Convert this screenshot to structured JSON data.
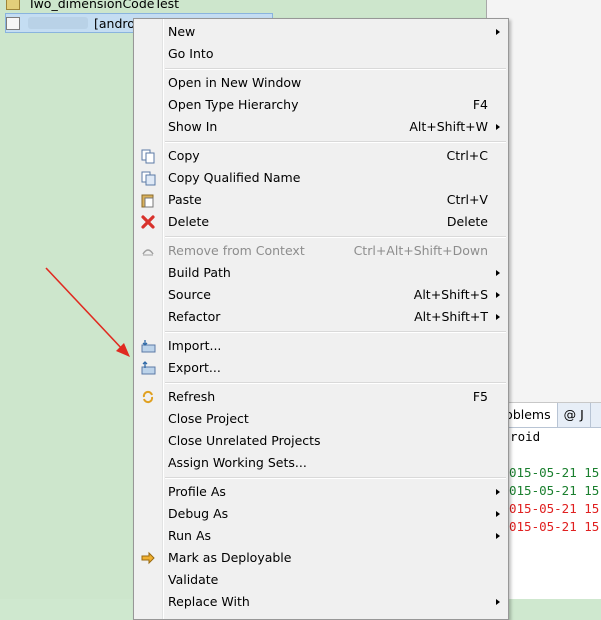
{
  "explorer": {
    "rows": [
      {
        "label": "Two_dimensionCodeTest"
      },
      {
        "label": "[android]"
      }
    ]
  },
  "right_panel": {
    "tabs": [
      {
        "label": "Problems"
      },
      {
        "label": "@ J"
      }
    ],
    "console_header": "ndroid",
    "log_lines": [
      {
        "text": "015-05-21 15",
        "color": "#1a7f2e"
      },
      {
        "text": "015-05-21 15",
        "color": "#1a7f2e"
      },
      {
        "text": "015-05-21 15",
        "color": "#e02020"
      },
      {
        "text": "015-05-21 15",
        "color": "#e02020"
      }
    ]
  },
  "menu": {
    "items": [
      {
        "label": "New",
        "shortcut": "",
        "submenu": true
      },
      {
        "label": "Go Into",
        "shortcut": ""
      },
      {
        "label": "Open in New Window",
        "shortcut": ""
      },
      {
        "label": "Open Type Hierarchy",
        "shortcut": "F4"
      },
      {
        "label": "Show In",
        "shortcut": "Alt+Shift+W",
        "submenu": true
      },
      {
        "label": "Copy",
        "shortcut": "Ctrl+C",
        "icon": "copy-icon"
      },
      {
        "label": "Copy Qualified Name",
        "shortcut": "",
        "icon": "copy-qualified-name-icon"
      },
      {
        "label": "Paste",
        "shortcut": "Ctrl+V",
        "icon": "paste-icon"
      },
      {
        "label": "Delete",
        "shortcut": "Delete",
        "icon": "delete-icon"
      },
      {
        "label": "Remove from Context",
        "shortcut": "Ctrl+Alt+Shift+Down",
        "icon": "remove-context-icon",
        "disabled": true
      },
      {
        "label": "Build Path",
        "shortcut": "",
        "submenu": true
      },
      {
        "label": "Source",
        "shortcut": "Alt+Shift+S",
        "submenu": true
      },
      {
        "label": "Refactor",
        "shortcut": "Alt+Shift+T",
        "submenu": true
      },
      {
        "label": "Import...",
        "shortcut": "",
        "icon": "import-icon"
      },
      {
        "label": "Export...",
        "shortcut": "",
        "icon": "export-icon"
      },
      {
        "label": "Refresh",
        "shortcut": "F5",
        "icon": "refresh-icon"
      },
      {
        "label": "Close Project",
        "shortcut": ""
      },
      {
        "label": "Close Unrelated Projects",
        "shortcut": ""
      },
      {
        "label": "Assign Working Sets...",
        "shortcut": ""
      },
      {
        "label": "Profile As",
        "shortcut": "",
        "submenu": true
      },
      {
        "label": "Debug As",
        "shortcut": "",
        "submenu": true
      },
      {
        "label": "Run As",
        "shortcut": "",
        "submenu": true
      },
      {
        "label": "Mark as Deployable",
        "shortcut": "",
        "icon": "deploy-icon"
      },
      {
        "label": "Validate",
        "shortcut": ""
      },
      {
        "label": "Replace With",
        "shortcut": "",
        "submenu": true
      }
    ]
  },
  "colors": {
    "annotation_arrow": "#e02a20",
    "explorer_bg": "#cde6cc",
    "menu_bg": "#f0f0f0"
  }
}
